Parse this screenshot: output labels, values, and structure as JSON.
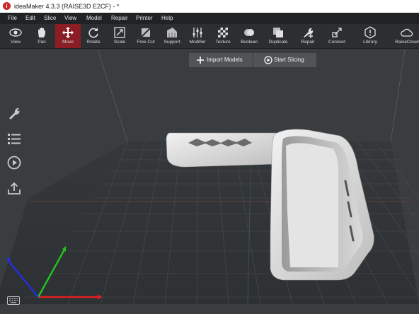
{
  "window": {
    "title": "ideaMaker 4.3.3 (RAISE3D E2CF) - *",
    "app_icon": "ideamaker-logo-icon"
  },
  "menu": [
    "File",
    "Edit",
    "Slice",
    "View",
    "Model",
    "Repair",
    "Printer",
    "Help"
  ],
  "toolbar": {
    "view": "View",
    "pan": "Pan",
    "move": "Move",
    "rotate": "Rotate",
    "scale": "Scale",
    "free_cut": "Free Cut",
    "support": "Support",
    "modifier": "Modifier",
    "texture": "Texture",
    "boolean": "Boolean",
    "duplicate": "Duplicate",
    "repair": "Repair",
    "connect": "Connect",
    "library": "Library",
    "raisecloud": "RaiseCloud",
    "active_tool": "Move"
  },
  "actions": {
    "import": "Import Models",
    "slice": "Start Slicing"
  },
  "side_icons": [
    "wrench-icon",
    "list-icon",
    "play-icon",
    "upload-icon",
    "keyboard-icon"
  ],
  "colors": {
    "accent": "#8b1d24",
    "axis_x": "#e02020",
    "axis_y": "#22c322",
    "axis_z": "#2030e0"
  }
}
